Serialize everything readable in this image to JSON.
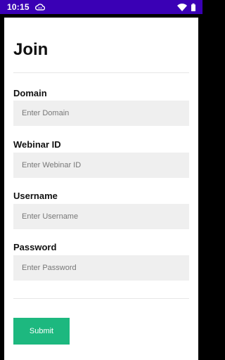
{
  "status_bar": {
    "time": "10:15",
    "icons": [
      "cloud-icon",
      "wifi-icon",
      "battery-icon"
    ],
    "background": "#3A00B5"
  },
  "form": {
    "title": "Join",
    "fields": [
      {
        "label": "Domain",
        "placeholder": "Enter Domain",
        "value": ""
      },
      {
        "label": "Webinar ID",
        "placeholder": "Enter Webinar ID",
        "value": ""
      },
      {
        "label": "Username",
        "placeholder": "Enter Username",
        "value": ""
      },
      {
        "label": "Password",
        "placeholder": "Enter Password",
        "value": ""
      }
    ],
    "submit_label": "Submit",
    "accent_color": "#1DB87F"
  }
}
